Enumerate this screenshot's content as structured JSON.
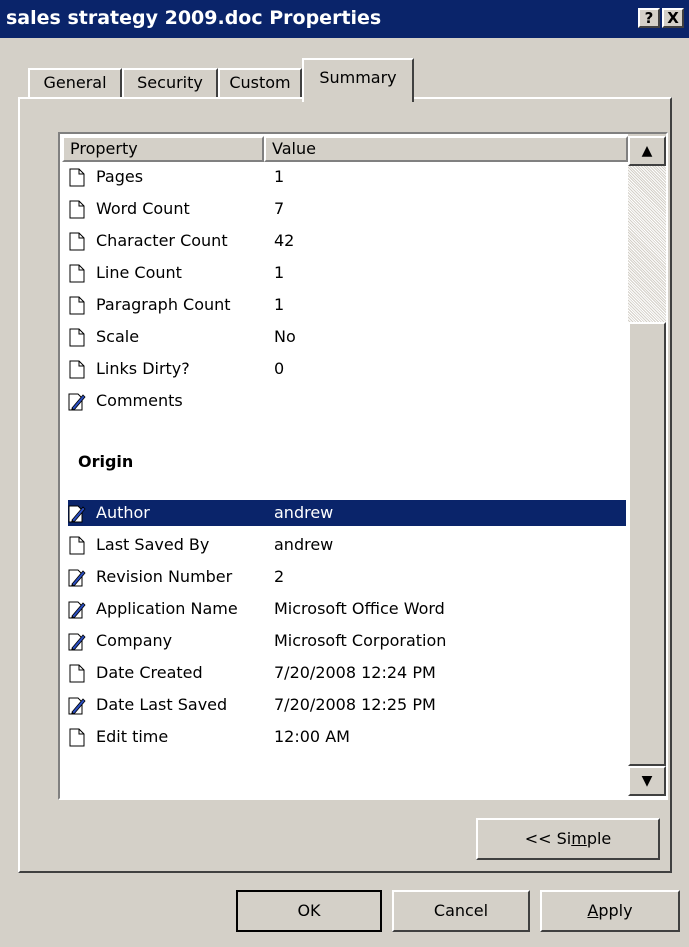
{
  "window": {
    "title": "sales strategy 2009.doc Properties",
    "help_label": "?",
    "close_label": "X"
  },
  "tabs": [
    {
      "label": "General",
      "active": false
    },
    {
      "label": "Security",
      "active": false
    },
    {
      "label": "Custom",
      "active": false
    },
    {
      "label": "Summary",
      "active": true
    }
  ],
  "list": {
    "columns": {
      "property": "Property",
      "value": "Value"
    },
    "rows": [
      {
        "icon": "document-icon",
        "property": "Pages",
        "value": "1"
      },
      {
        "icon": "document-icon",
        "property": "Word Count",
        "value": "7"
      },
      {
        "icon": "document-icon",
        "property": "Character Count",
        "value": "42"
      },
      {
        "icon": "document-icon",
        "property": "Line Count",
        "value": "1"
      },
      {
        "icon": "document-icon",
        "property": "Paragraph Count",
        "value": "1"
      },
      {
        "icon": "document-icon",
        "property": "Scale",
        "value": "No"
      },
      {
        "icon": "document-icon",
        "property": "Links Dirty?",
        "value": "0"
      },
      {
        "icon": "edit-document-icon",
        "property": "Comments",
        "value": ""
      }
    ],
    "section_origin": "Origin",
    "origin_rows": [
      {
        "icon": "edit-document-icon",
        "property": "Author",
        "value": "andrew",
        "selected": true
      },
      {
        "icon": "document-icon",
        "property": "Last Saved By",
        "value": "andrew"
      },
      {
        "icon": "edit-document-icon",
        "property": "Revision Number",
        "value": "2"
      },
      {
        "icon": "edit-document-icon",
        "property": "Application Name",
        "value": "Microsoft Office Word"
      },
      {
        "icon": "edit-document-icon",
        "property": "Company",
        "value": "Microsoft Corporation"
      },
      {
        "icon": "document-icon",
        "property": "Date Created",
        "value": "7/20/2008 12:24 PM"
      },
      {
        "icon": "edit-document-icon",
        "property": "Date Last Saved",
        "value": "7/20/2008 12:25 PM"
      },
      {
        "icon": "document-icon",
        "property": "Edit time",
        "value": " 12:00 AM"
      }
    ]
  },
  "buttons": {
    "simple_prefix": "<< Si",
    "simple_accel": "m",
    "simple_suffix": "ple",
    "ok": "OK",
    "cancel": "Cancel",
    "apply_accel": "A",
    "apply_rest": "pply"
  },
  "colors": {
    "titlebar": "#0a246a",
    "face": "#d4d0c8",
    "selection": "#0a246a"
  }
}
